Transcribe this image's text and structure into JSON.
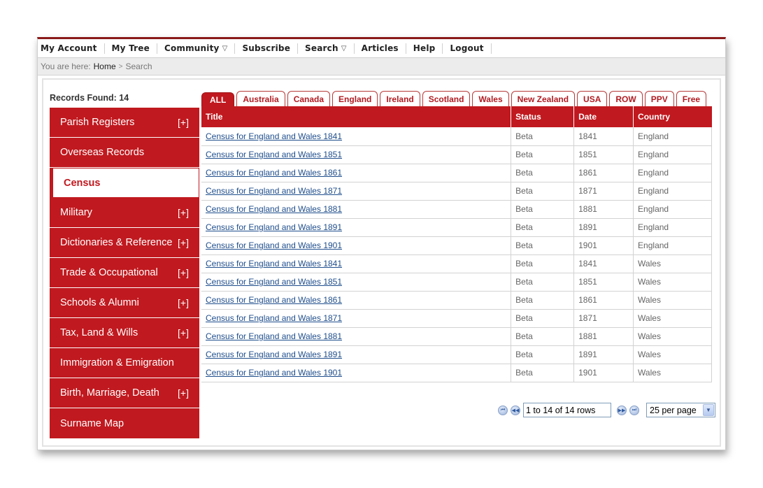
{
  "topnav": {
    "items": [
      {
        "label": "My Account",
        "dropdown": false
      },
      {
        "label": "My Tree",
        "dropdown": false
      },
      {
        "label": "Community",
        "dropdown": true
      },
      {
        "label": "Subscribe",
        "dropdown": false
      },
      {
        "label": "Search",
        "dropdown": true
      },
      {
        "label": "Articles",
        "dropdown": false
      },
      {
        "label": "Help",
        "dropdown": false
      },
      {
        "label": "Logout",
        "dropdown": false
      }
    ],
    "caret_glyph": "▽"
  },
  "breadcrumb": {
    "prefix": "You are here:",
    "home": "Home",
    "separator": ">",
    "current": "Search"
  },
  "records_found": "Records Found: 14",
  "sidebar": {
    "expand_label": "[+]",
    "items": [
      {
        "label": "Parish Registers",
        "expandable": true,
        "active": false
      },
      {
        "label": "Overseas Records",
        "expandable": false,
        "active": false
      },
      {
        "label": "Census",
        "expandable": false,
        "active": true
      },
      {
        "label": "Military",
        "expandable": true,
        "active": false
      },
      {
        "label": "Dictionaries & Reference",
        "expandable": true,
        "active": false
      },
      {
        "label": "Trade & Occupational",
        "expandable": true,
        "active": false
      },
      {
        "label": "Schools & Alumni",
        "expandable": true,
        "active": false
      },
      {
        "label": "Tax, Land & Wills",
        "expandable": true,
        "active": false
      },
      {
        "label": "Immigration & Emigration",
        "expandable": false,
        "active": false
      },
      {
        "label": "Birth, Marriage, Death",
        "expandable": true,
        "active": false
      },
      {
        "label": "Surname Map",
        "expandable": false,
        "active": false
      }
    ]
  },
  "tabs": {
    "active": "ALL",
    "items": [
      "ALL",
      "Australia",
      "Canada",
      "England",
      "Ireland",
      "Scotland",
      "Wales",
      "New Zealand",
      "USA",
      "ROW",
      "PPV",
      "Free"
    ]
  },
  "table": {
    "columns": [
      "Title",
      "Status",
      "Date",
      "Country"
    ],
    "rows": [
      [
        "Census for England and Wales 1841",
        "Beta",
        "1841",
        "England"
      ],
      [
        "Census for England and Wales 1851",
        "Beta",
        "1851",
        "England"
      ],
      [
        "Census for England and Wales 1861",
        "Beta",
        "1861",
        "England"
      ],
      [
        "Census for England and Wales 1871",
        "Beta",
        "1871",
        "England"
      ],
      [
        "Census for England and Wales 1881",
        "Beta",
        "1881",
        "England"
      ],
      [
        "Census for England and Wales 1891",
        "Beta",
        "1891",
        "England"
      ],
      [
        "Census for England and Wales 1901",
        "Beta",
        "1901",
        "England"
      ],
      [
        "Census for England and Wales 1841",
        "Beta",
        "1841",
        "Wales"
      ],
      [
        "Census for England and Wales 1851",
        "Beta",
        "1851",
        "Wales"
      ],
      [
        "Census for England and Wales 1861",
        "Beta",
        "1861",
        "Wales"
      ],
      [
        "Census for England and Wales 1871",
        "Beta",
        "1871",
        "Wales"
      ],
      [
        "Census for England and Wales 1881",
        "Beta",
        "1881",
        "Wales"
      ],
      [
        "Census for England and Wales 1891",
        "Beta",
        "1891",
        "Wales"
      ],
      [
        "Census for England and Wales 1901",
        "Beta",
        "1901",
        "Wales"
      ]
    ]
  },
  "pager": {
    "first_icon": "first-page-icon",
    "prev_icon": "prev-page-icon",
    "next_icon": "next-page-icon",
    "last_icon": "last-page-icon",
    "range_text": "1 to 14 of 14 rows",
    "per_page": "25 per page",
    "glyphs": {
      "first": "⏮",
      "prev": "◀◀",
      "next": "▶▶",
      "last": "⏭",
      "dropdown": "▼"
    }
  },
  "colors": {
    "brand_red": "#c0191f",
    "frame_top": "#8b1a1a",
    "link_blue": "#1f4e8c"
  }
}
